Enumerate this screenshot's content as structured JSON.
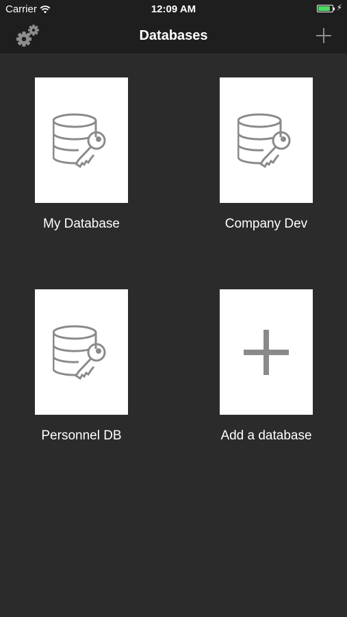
{
  "status": {
    "carrier": "Carrier",
    "time": "12:09 AM",
    "battery_level": 0.85,
    "battery_color": "#4cd964",
    "wifi_icon": "wifi-icon",
    "charge_icon": "lightning-icon"
  },
  "nav": {
    "title": "Databases",
    "settings_icon": "gears-icon",
    "add_icon": "plus-icon"
  },
  "databases": [
    {
      "label": "My Database",
      "icon": "database-key-icon"
    },
    {
      "label": "Company Dev",
      "icon": "database-key-icon"
    },
    {
      "label": "Personnel DB",
      "icon": "database-key-icon"
    }
  ],
  "add_tile": {
    "label": "Add a database",
    "icon": "plus-icon"
  }
}
